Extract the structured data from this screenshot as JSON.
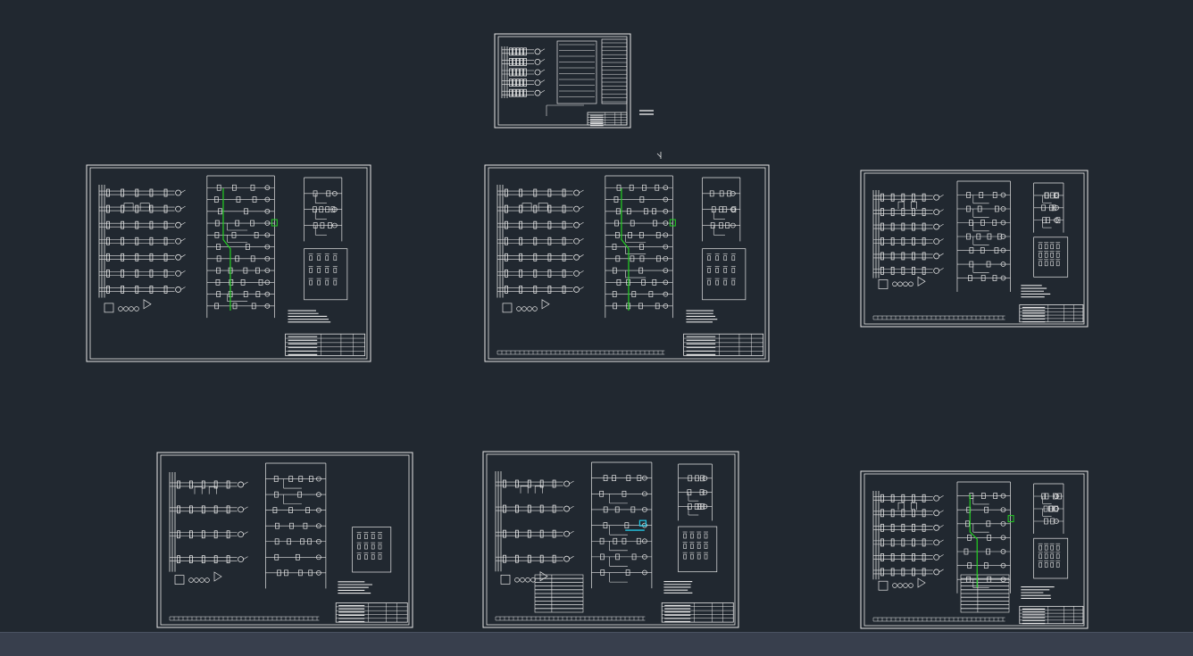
{
  "app": {
    "title": "",
    "theme": {
      "background": "#212830",
      "line": "#e6e6e6",
      "highlight_green": "#22d022",
      "highlight_cyan": "#22c8e6",
      "statusbar": "#383f4d"
    }
  },
  "drawing": {
    "sheets": [
      {
        "id": "cover-sheet",
        "kind": "overview"
      },
      {
        "id": "sheet-1",
        "kind": "schematic-large",
        "highlight": "green"
      },
      {
        "id": "sheet-2",
        "kind": "schematic-large",
        "highlight": "green"
      },
      {
        "id": "sheet-3",
        "kind": "schematic-small",
        "highlight": "none"
      },
      {
        "id": "sheet-4",
        "kind": "schematic-medium",
        "highlight": "none"
      },
      {
        "id": "sheet-5",
        "kind": "schematic-medium",
        "highlight": "cyan"
      },
      {
        "id": "sheet-6",
        "kind": "schematic-small",
        "highlight": "green"
      }
    ]
  },
  "statusbar": {
    "text": ""
  }
}
